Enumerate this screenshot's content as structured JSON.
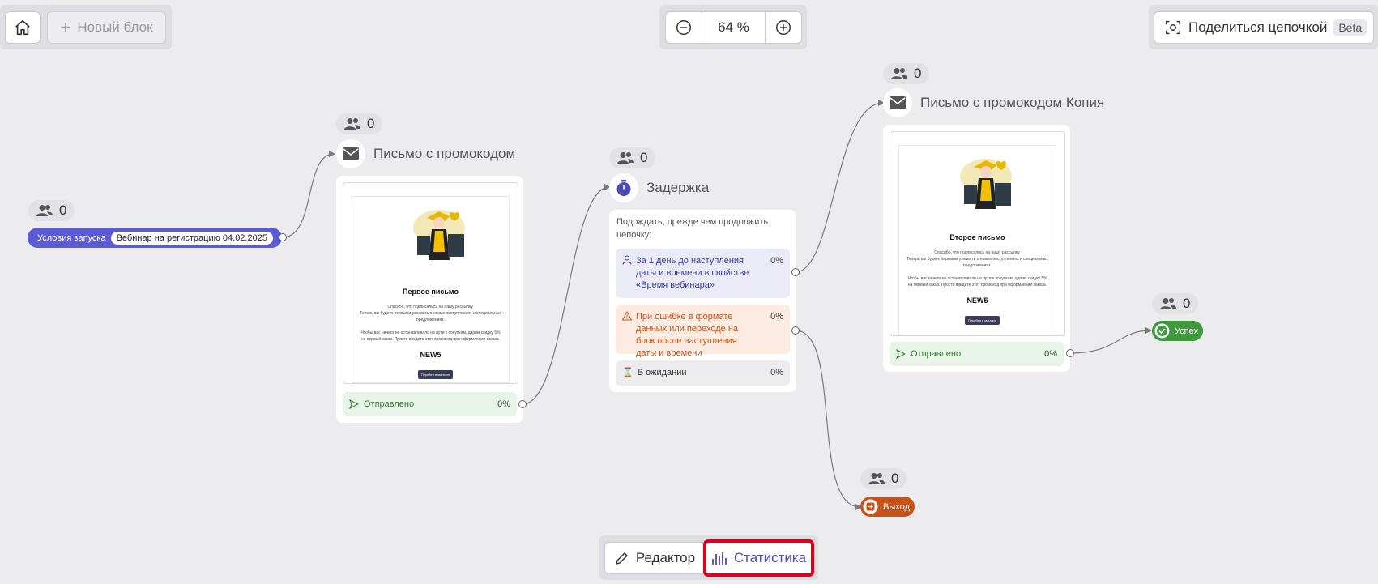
{
  "toolbar": {
    "home_icon": "home-icon",
    "new_block_label": "Новый блок",
    "zoom_value": "64 %",
    "share_label": "Поделиться цепочкой",
    "share_badge": "Beta"
  },
  "start": {
    "count": "0",
    "label": "Условия запуска",
    "tag": "Вебинар на регистрацию 04.02.2025"
  },
  "email1": {
    "count": "0",
    "title": "Письмо с промокодом",
    "preview_title": "Первое письмо",
    "preview_text1": "Спасибо, что подписались на нашу рассылку.",
    "preview_text2": "Теперь вы будете первыми узнавать о новых поступлениях и специальных предложениях.",
    "preview_text3": "Чтобы вас ничего не останавливало на пути к покупкам, дарим скидку 5% на первый заказ. Просто введите этот промокод при оформлении заказа.",
    "promo_code": "NEW5",
    "preview_button": "Перейти в магазин",
    "sent_label": "Отправлено",
    "sent_pct": "0%"
  },
  "delay": {
    "count": "0",
    "title": "Задержка",
    "description": "Подождать, прежде чем продолжить цепочку:",
    "option1_text": "За 1 день до наступления даты и времени в свойстве «Время вебинара»",
    "option1_pct": "0%",
    "option2_text": "При ошибке в формате данных или переходе на блок после наступления даты и времени",
    "option2_pct": "0%",
    "waiting_label": "В ожидании",
    "waiting_pct": "0%"
  },
  "email2": {
    "count": "0",
    "title": "Письмо с промокодом Копия",
    "preview_title": "Второе письмо",
    "preview_text1": "Спасибо, что подписались на нашу рассылку.",
    "preview_text2": "Теперь вы будете первыми узнавать о новых поступлениях и специальных предложениях.",
    "preview_text3": "Чтобы вас ничего не останавливало на пути к покупкам, дарим скидку 5% на первый заказ. Просто введите этот промокод при оформлении заказа.",
    "promo_code": "NEW5",
    "preview_button": "Перейти в магазин",
    "sent_label": "Отправлено",
    "sent_pct": "0%"
  },
  "success": {
    "count": "0",
    "label": "Успех"
  },
  "exit": {
    "count": "0",
    "label": "Выход"
  },
  "bottom_tabs": {
    "editor_label": "Редактор",
    "stats_label": "Статистика"
  },
  "colors": {
    "start_pill": "#5b5bd6",
    "success": "#3f9a3f",
    "exit": "#c8531a",
    "highlight": "#e0001b",
    "accent": "#4a4ab8"
  }
}
